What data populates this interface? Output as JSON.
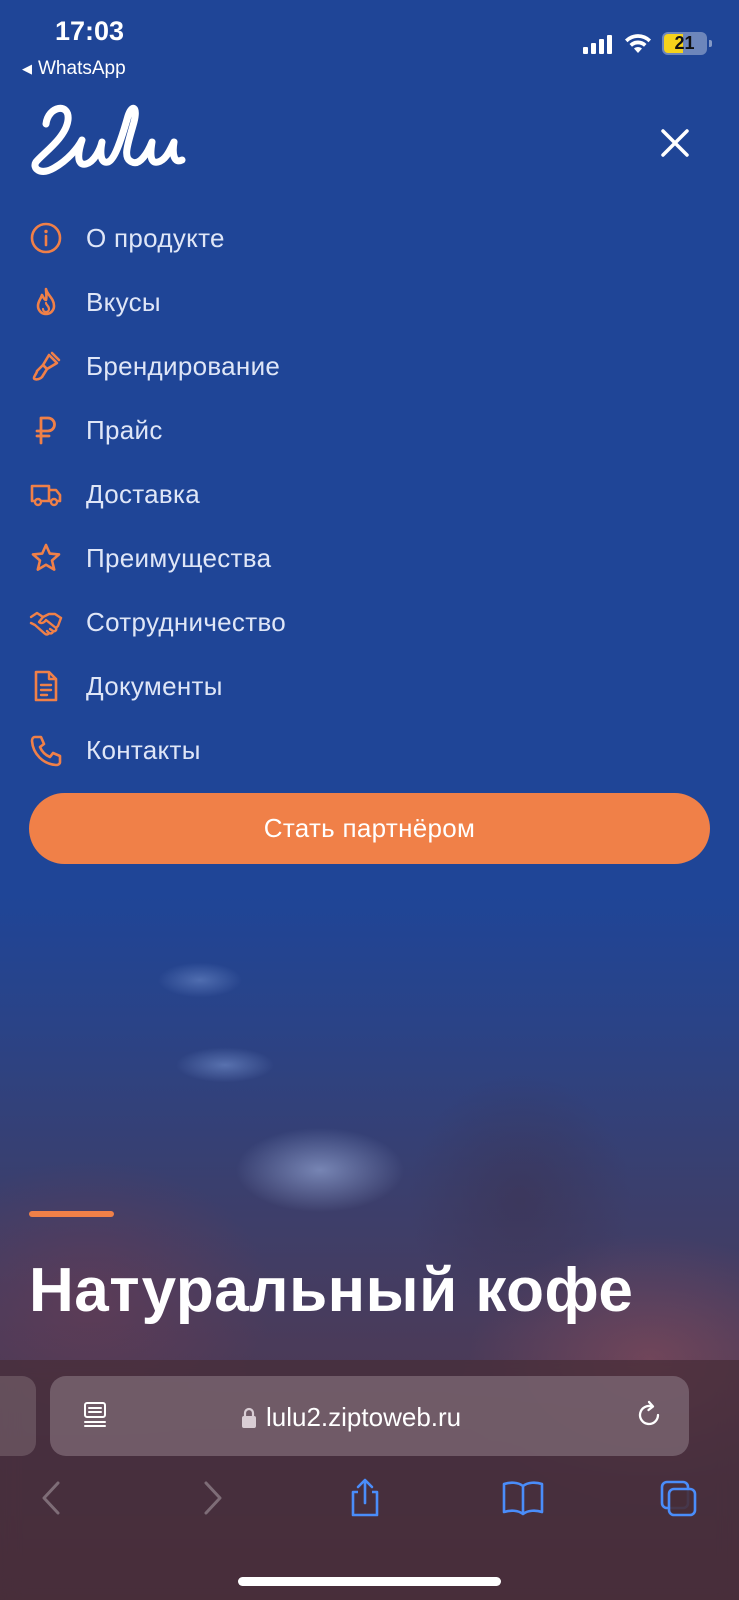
{
  "status_bar": {
    "time": "17:03",
    "back_app": "WhatsApp",
    "battery": "21"
  },
  "colors": {
    "background": "#1e4396",
    "accent": "#f08048",
    "menu_text": "#dfe6f7"
  },
  "header": {
    "logo_text": "Lulu",
    "close_icon": "close-icon"
  },
  "menu": {
    "items": [
      {
        "label": "О продукте",
        "icon": "info-icon"
      },
      {
        "label": "Вкусы",
        "icon": "flame-icon"
      },
      {
        "label": "Брендирование",
        "icon": "paintbrush-icon"
      },
      {
        "label": "Прайс",
        "icon": "ruble-icon"
      },
      {
        "label": "Доставка",
        "icon": "truck-icon"
      },
      {
        "label": "Преимущества",
        "icon": "star-icon"
      },
      {
        "label": "Сотрудничество",
        "icon": "handshake-icon"
      },
      {
        "label": "Документы",
        "icon": "document-icon"
      },
      {
        "label": "Контакты",
        "icon": "phone-icon"
      }
    ],
    "partner_button": "Стать партнёром"
  },
  "hero": {
    "title": "Натуральный кофе"
  },
  "browser": {
    "url": "lulu2.ziptoweb.ru"
  }
}
